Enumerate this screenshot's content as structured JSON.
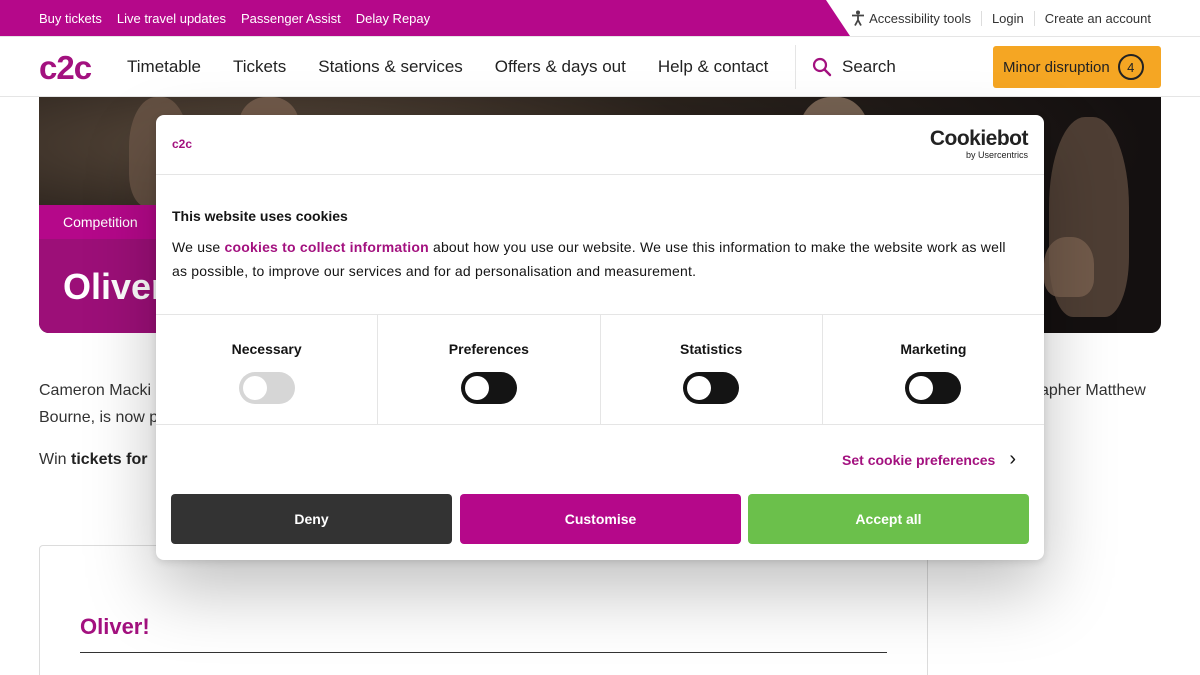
{
  "utility": {
    "links": [
      "Buy tickets",
      "Live travel updates",
      "Passenger Assist",
      "Delay Repay"
    ],
    "accessibility": "Accessibility tools",
    "login": "Login",
    "create_account": "Create an account"
  },
  "nav": {
    "logo": "c2c",
    "items": [
      "Timetable",
      "Tickets",
      "Stations & services",
      "Offers & days out",
      "Help & contact"
    ],
    "search": "Search",
    "disruption_label": "Minor disruption",
    "disruption_count": "4"
  },
  "hero": {
    "tag": "Competition",
    "title": "Oliver"
  },
  "content": {
    "p1_start": "Cameron Macki",
    "p1_end": "apher Matthew",
    "p1_line2": "Bourne, is now p",
    "p2_start": "Win ",
    "p2_bold": "tickets for",
    "card_title": "Oliver!"
  },
  "dialog": {
    "brand": "c2c",
    "provider": "Cookiebot",
    "provider_by": "by Usercentrics",
    "title": "This website uses cookies",
    "text_before": "We use ",
    "text_link": "cookies to collect information",
    "text_after": " about how you use our website. We use this information to make the website work as well as possible, to improve our services and for ad personalisation and measurement.",
    "categories": [
      "Necessary",
      "Preferences",
      "Statistics",
      "Marketing"
    ],
    "set_prefs": "Set cookie preferences",
    "deny": "Deny",
    "customise": "Customise",
    "accept": "Accept all"
  },
  "colors": {
    "brand": "#b5088a",
    "accent_dark": "#a3117f",
    "disruption": "#f5a623",
    "accept": "#6bc04b",
    "deny": "#333333"
  }
}
